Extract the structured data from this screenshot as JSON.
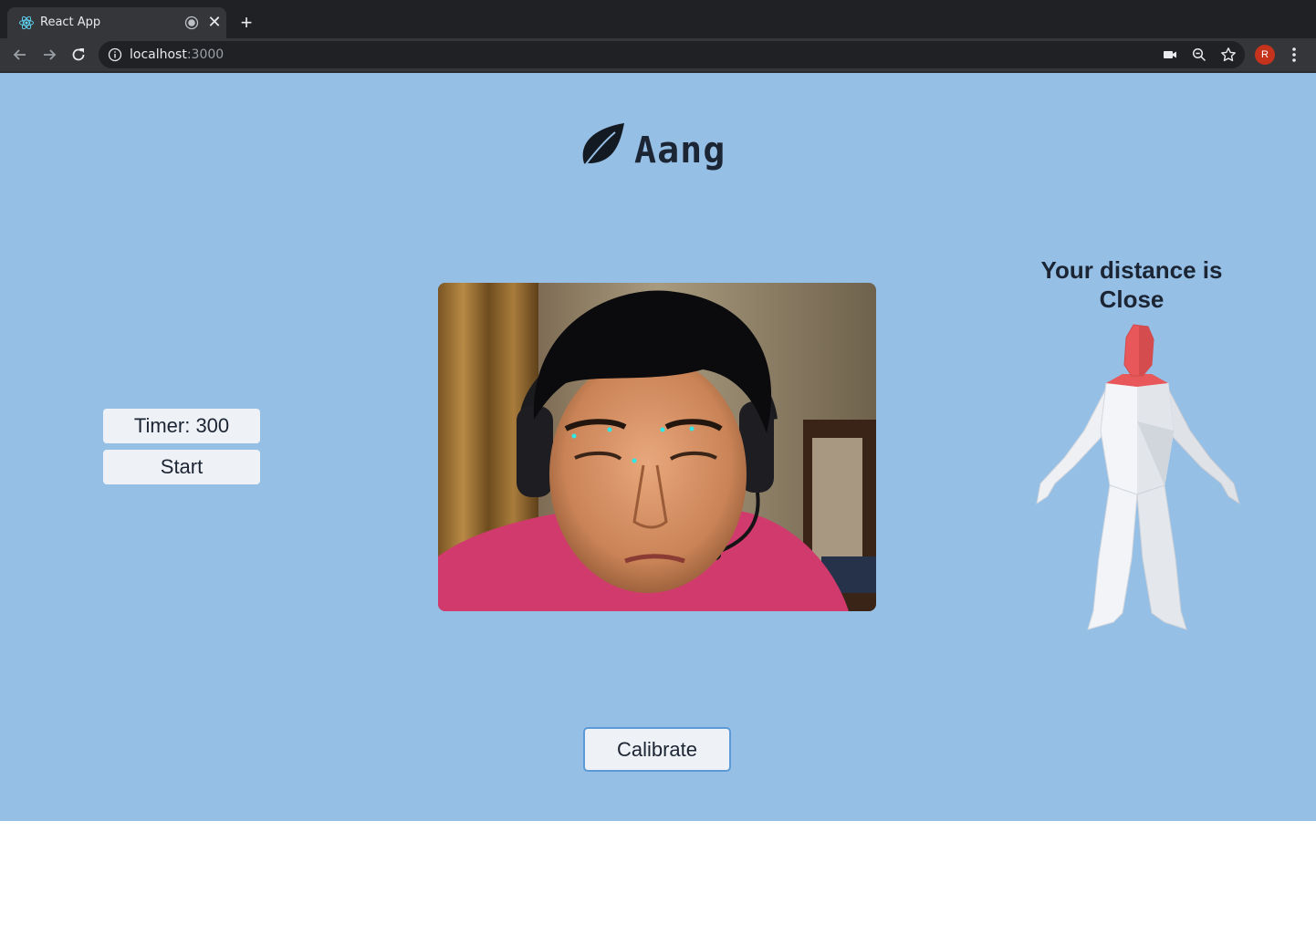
{
  "browser": {
    "tab_title": "React App",
    "new_tab_symbol": "+",
    "url_host": "localhost",
    "url_port": ":3000",
    "profile_initial": "R",
    "icons": [
      "react-favicon-icon",
      "recording-icon",
      "close-icon",
      "back-arrow-icon",
      "forward-arrow-icon",
      "reload-icon",
      "info-icon",
      "camera-icon",
      "zoom-icon",
      "star-icon",
      "kebab-menu-icon"
    ]
  },
  "app": {
    "brand": "Aang",
    "logo_icon": "leaf-icon",
    "timer_label": "Timer: 300",
    "start_label": "Start",
    "status_line1": "Your distance is",
    "status_line2": "Close",
    "calibrate_label": "Calibrate",
    "colors": {
      "background": "#96bfe6",
      "accent_border": "#5b9ad6",
      "figure_highlight": "#e8585a",
      "landmark_dot": "#2ee8e8"
    }
  }
}
